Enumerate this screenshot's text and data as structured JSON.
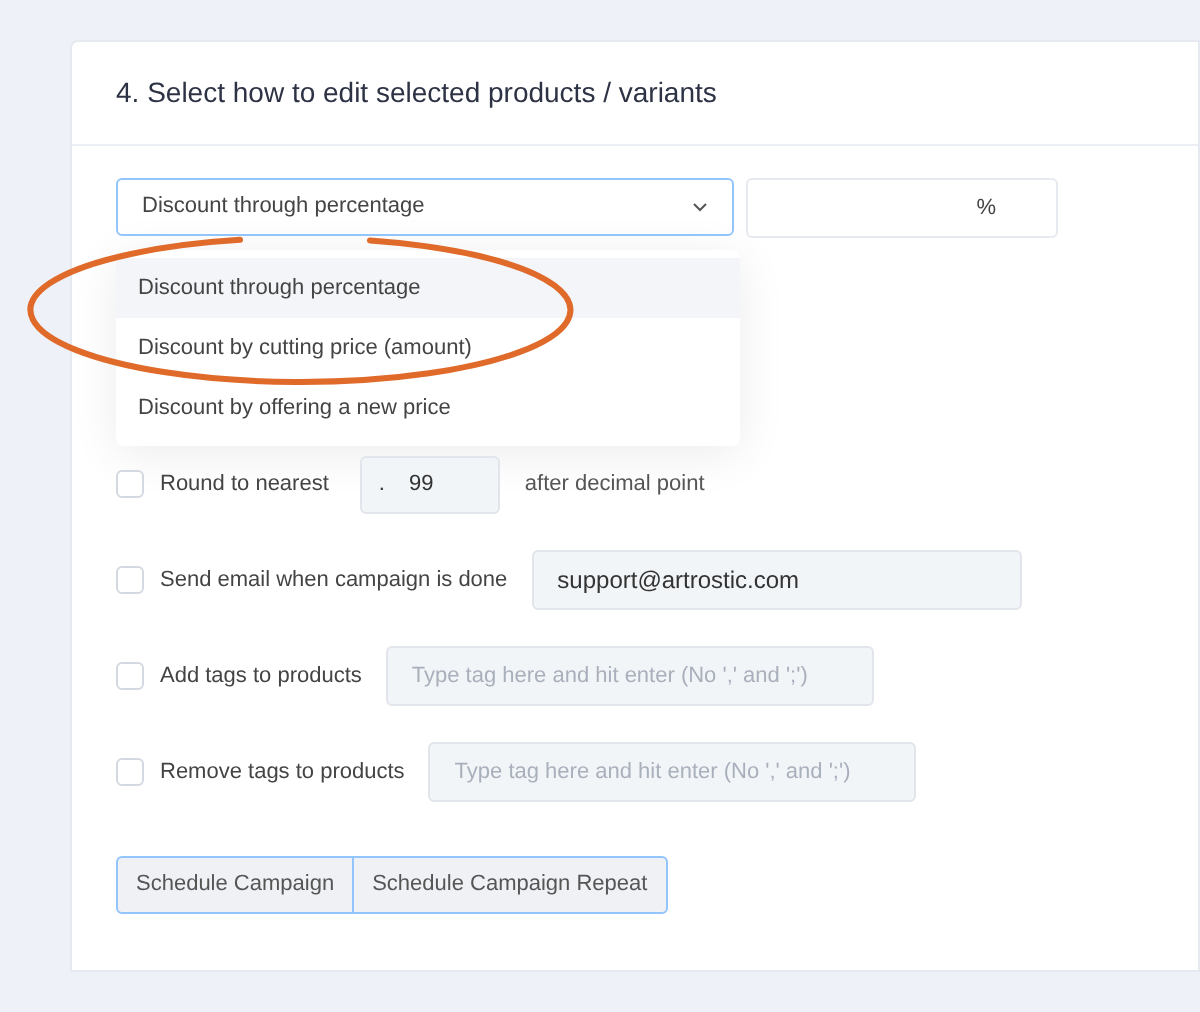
{
  "section": {
    "title": "4. Select how to edit selected products / variants"
  },
  "edit_mode": {
    "value": "Discount through percentage",
    "expanded": true,
    "options": [
      {
        "label": "Discount through percentage",
        "selected": true
      },
      {
        "label": "Discount by cutting price (amount)",
        "selected": false
      },
      {
        "label": "Discount by offering a new price",
        "selected": false
      }
    ]
  },
  "amount_field": {
    "unit": "%"
  },
  "options": [
    {
      "kind": "round",
      "label": "Round to nearest",
      "checked": false,
      "prefix": ".",
      "value": "99",
      "suffix": "after decimal point"
    },
    {
      "kind": "email",
      "label": "Send email when campaign is done",
      "checked": false,
      "value": "support@artrostic.com"
    },
    {
      "kind": "tags",
      "label": "Add tags to products",
      "checked": false,
      "placeholder": "Type tag here and hit enter (No ',' and ';')"
    },
    {
      "kind": "tags",
      "label": "Remove tags to products",
      "checked": false,
      "placeholder": "Type tag here and hit enter (No ',' and ';')"
    }
  ],
  "buttons": [
    {
      "label": "Schedule Campaign"
    },
    {
      "label": "Schedule Campaign Repeat"
    }
  ]
}
